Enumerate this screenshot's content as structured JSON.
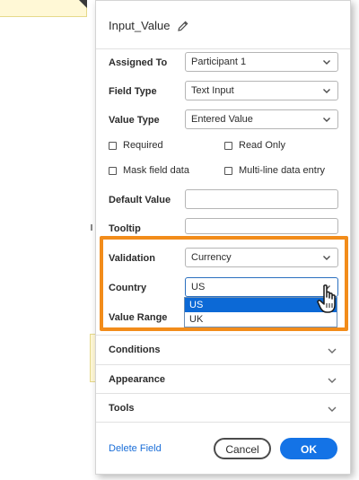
{
  "panel": {
    "title": "Input_Value",
    "assigned_to": {
      "label": "Assigned To",
      "value": "Participant 1"
    },
    "field_type": {
      "label": "Field Type",
      "value": "Text Input"
    },
    "value_type": {
      "label": "Value Type",
      "value": "Entered Value"
    },
    "checkboxes": {
      "required": "Required",
      "read_only": "Read Only",
      "mask": "Mask field data",
      "multiline": "Multi-line data entry"
    },
    "default_value": {
      "label": "Default Value",
      "value": ""
    },
    "tooltip": {
      "label": "Tooltip",
      "value": ""
    },
    "validation": {
      "label": "Validation",
      "value": "Currency"
    },
    "country": {
      "label": "Country",
      "value": "US",
      "options": [
        "US",
        "UK"
      ],
      "selected": "US"
    },
    "value_range": {
      "label": "Value Range"
    },
    "sections": {
      "conditions": "Conditions",
      "appearance": "Appearance",
      "tools": "Tools"
    },
    "footer": {
      "delete": "Delete Field",
      "cancel": "Cancel",
      "ok": "OK"
    }
  },
  "colors": {
    "highlight": "#f28c1a",
    "primary": "#1473e6",
    "link": "#1a6ed8",
    "selected_option": "#0c69d6"
  },
  "icons": {
    "title": "pencil-icon",
    "dropdown": "chevron-down-icon",
    "cursor": "hand-pointer-icon"
  }
}
